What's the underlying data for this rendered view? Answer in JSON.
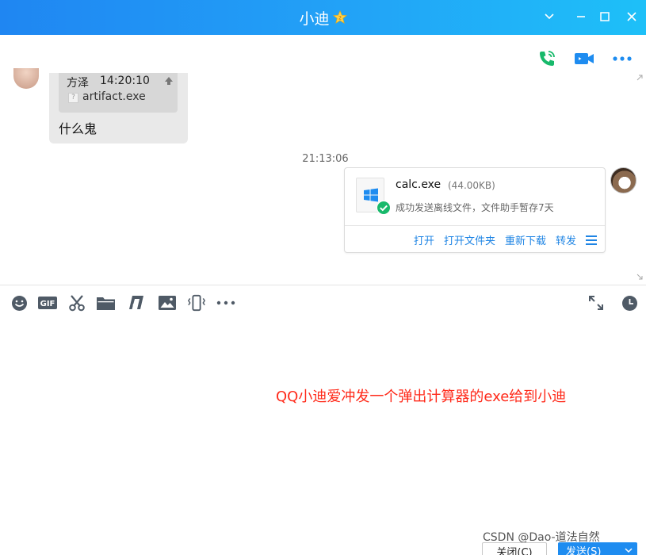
{
  "window": {
    "title": "小迪"
  },
  "chat": {
    "quoted": {
      "name": "方泽",
      "time": "14:20:10",
      "file": "artifact.exe",
      "file_icon": "?"
    },
    "message": "什么鬼",
    "timestamp": "21:13:06",
    "file_card": {
      "name": "calc.exe",
      "size": "(44.00KB)",
      "status": "成功发送离线文件，文件助手暂存7天",
      "actions": {
        "open": "打开",
        "open_folder": "打开文件夹",
        "redownload": "重新下载",
        "forward": "转发"
      }
    }
  },
  "compose": {
    "text": "QQ小迪爱冲发一个弹出计算器的exe给到小迪"
  },
  "footer": {
    "watermark": "CSDN @Dao-道法自然",
    "close_label": "关闭(C)",
    "send_label": "发送(S)"
  },
  "colors": {
    "title_bar_start": "#1f86f2",
    "title_bar_end": "#1ec0f8",
    "link": "#1e84e4",
    "accent_green": "#18b96b",
    "highlight_red": "#ff2a1a"
  }
}
